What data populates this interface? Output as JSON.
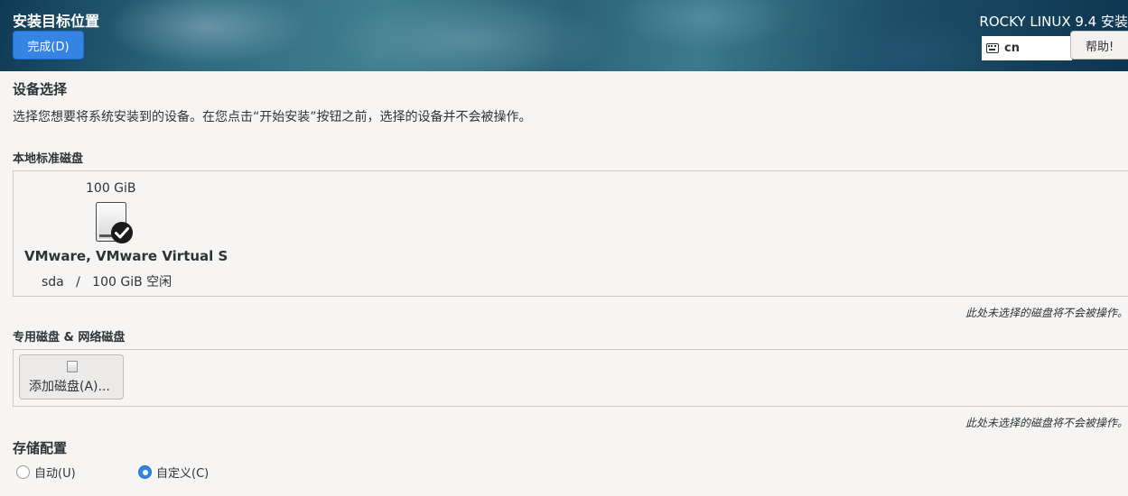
{
  "header": {
    "title": "安装目标位置",
    "done_label": "完成(D)",
    "product": "ROCKY LINUX 9.4 安装",
    "keyboard_layout": "cn",
    "help_label": "帮助!"
  },
  "device_selection": {
    "heading": "设备选择",
    "description": "选择您想要将系统安装到的设备。在您点击“开始安装”按钮之前，选择的设备并不会被操作。"
  },
  "local_disks": {
    "heading": "本地标准磁盘",
    "disks": [
      {
        "size": "100 GiB",
        "name": "VMware, VMware Virtual S",
        "info": "sda   /   100 GiB 空闲",
        "selected": true
      }
    ],
    "note": "此处未选择的磁盘将不会被操作。"
  },
  "specialized_disks": {
    "heading": "专用磁盘 & 网络磁盘",
    "add_label": "添加磁盘(A)...",
    "note": "此处未选择的磁盘将不会被操作。"
  },
  "storage_config": {
    "heading": "存储配置",
    "options": [
      {
        "label": "自动(U)",
        "checked": false
      },
      {
        "label": "自定义(C)",
        "checked": true
      }
    ]
  },
  "icons": {
    "keyboard": "keyboard-icon",
    "disk": "harddisk-icon",
    "selected": "checkmark-icon",
    "add_disk": "disk-small-icon"
  },
  "colors": {
    "accent": "#3584e4",
    "background": "#f6f5f4",
    "text": "#2e3436"
  }
}
